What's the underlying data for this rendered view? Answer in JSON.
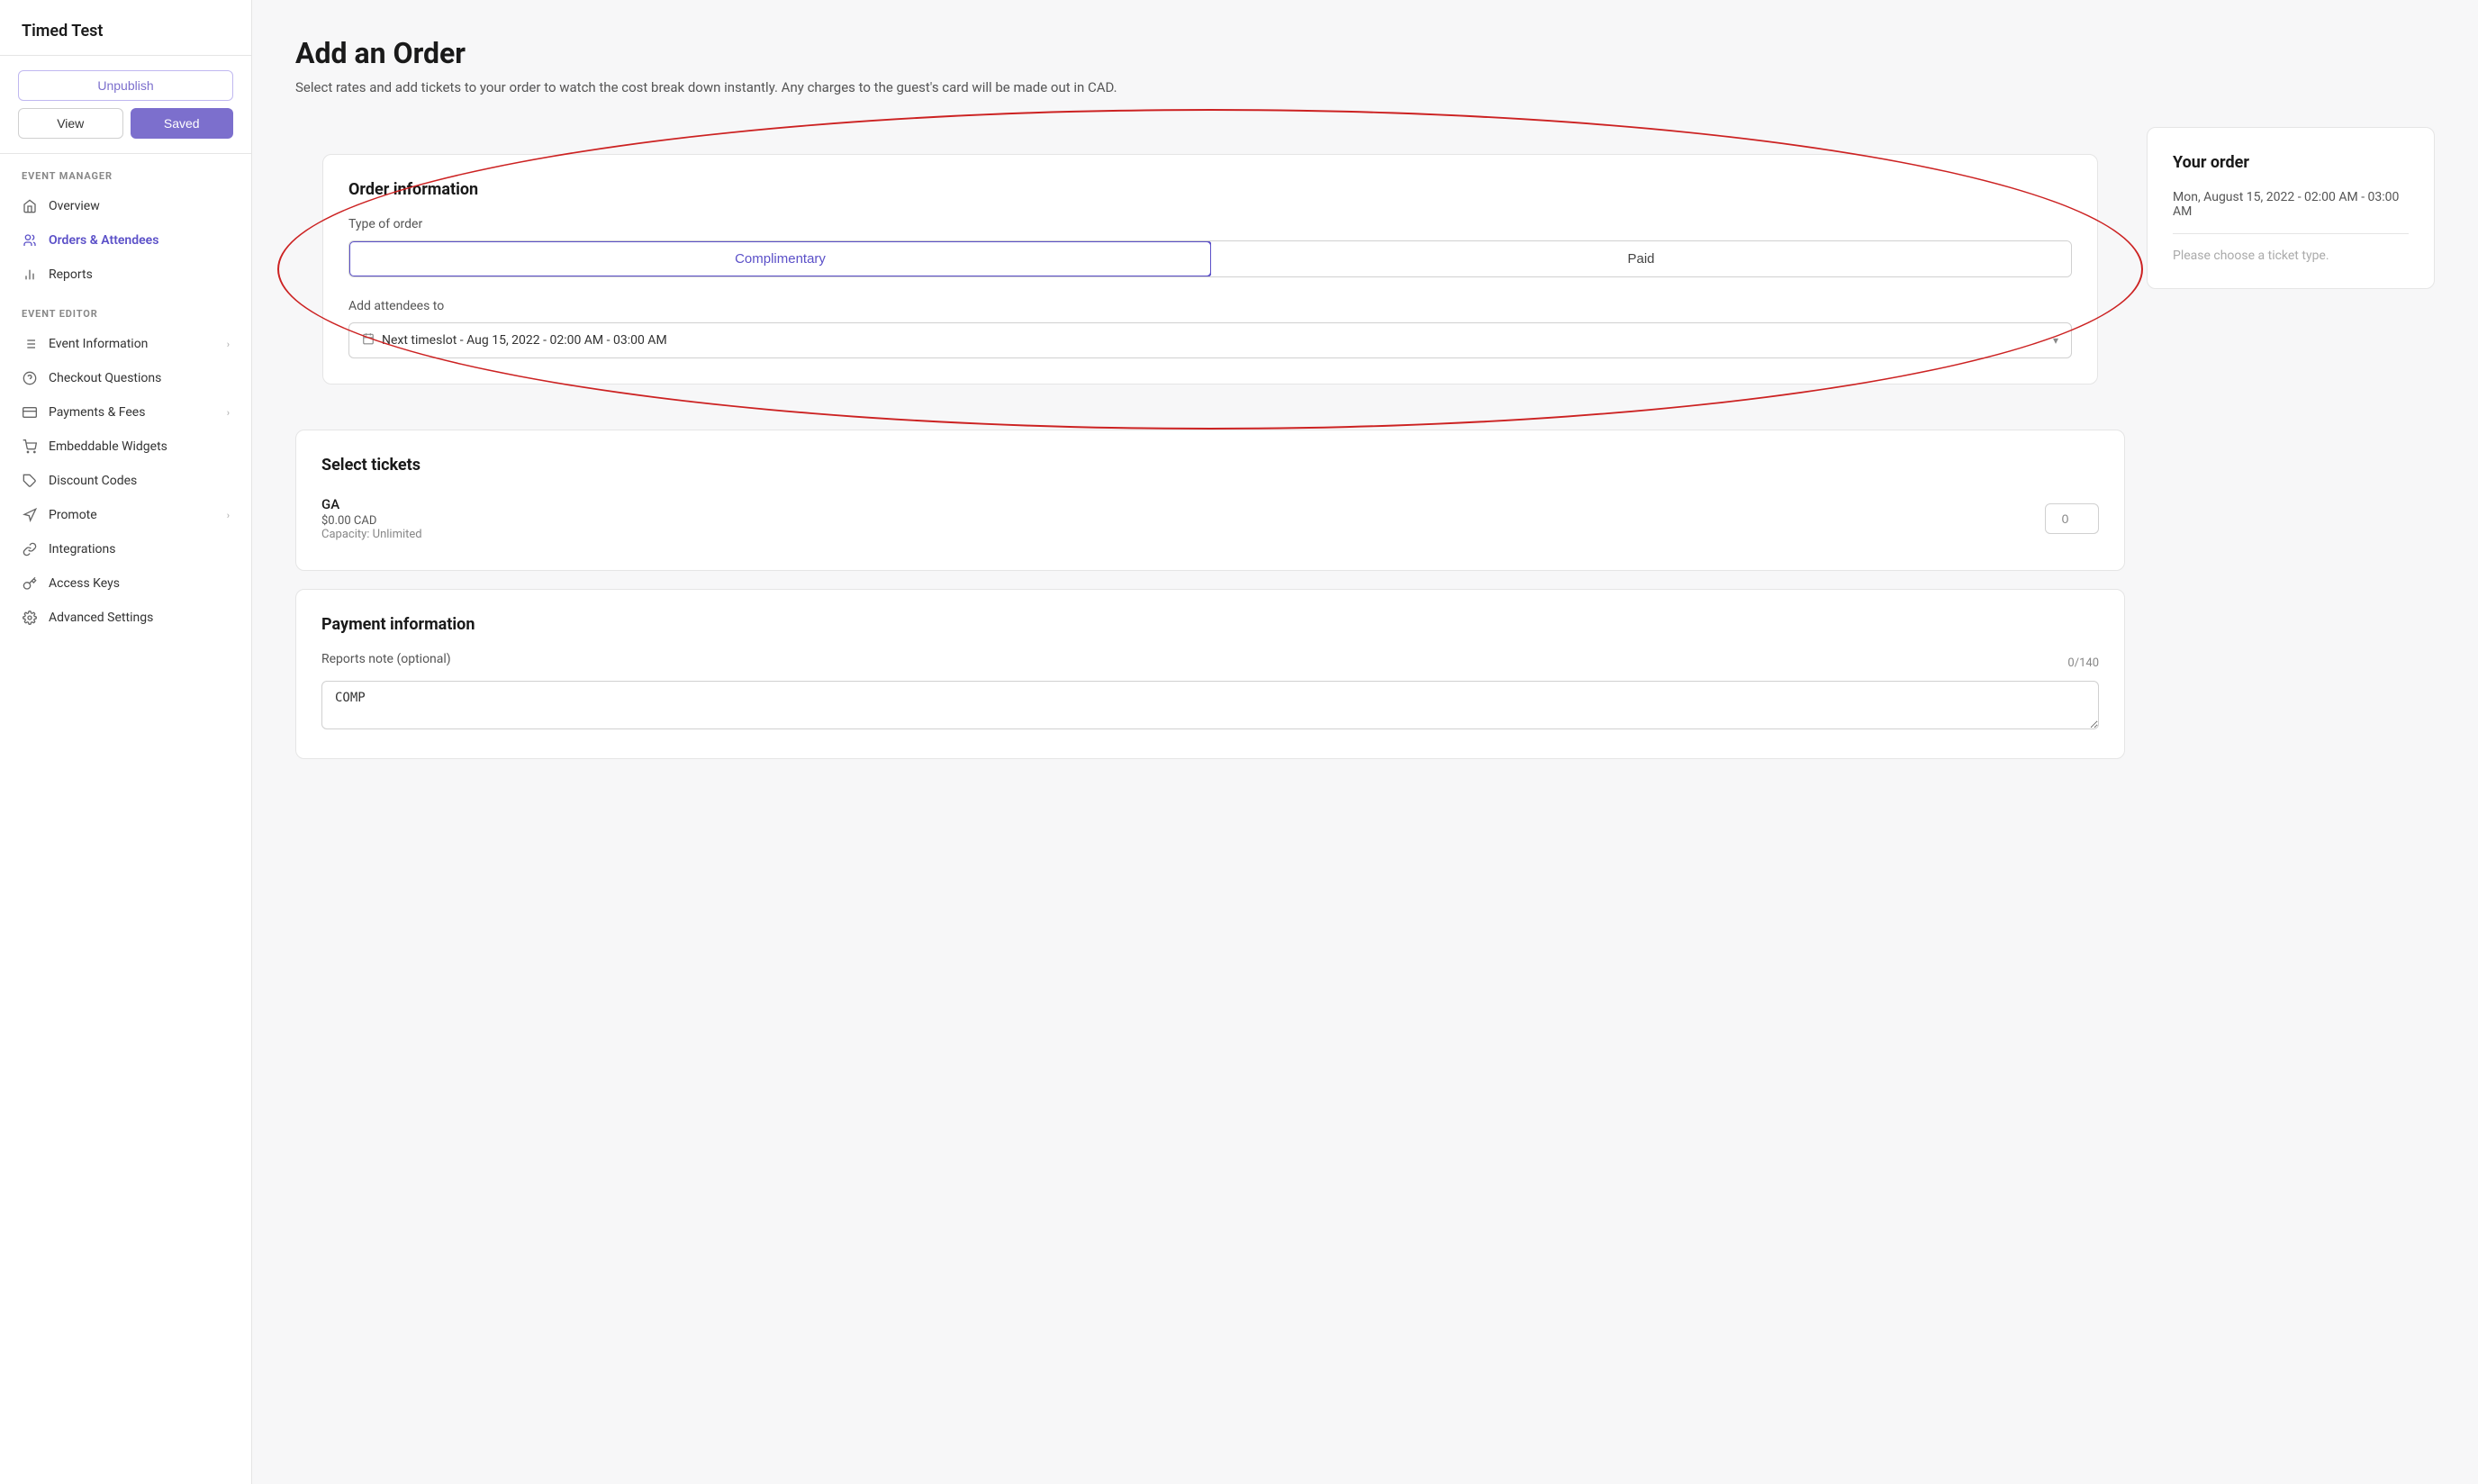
{
  "sidebar": {
    "title": "Timed Test",
    "buttons": {
      "unpublish": "Unpublish",
      "view": "View",
      "saved": "Saved"
    },
    "event_manager_label": "EVENT MANAGER",
    "event_manager_items": [
      {
        "id": "overview",
        "label": "Overview",
        "icon": "home"
      },
      {
        "id": "orders-attendees",
        "label": "Orders & Attendees",
        "icon": "people",
        "active": true
      },
      {
        "id": "reports",
        "label": "Reports",
        "icon": "bar-chart"
      }
    ],
    "event_editor_label": "EVENT EDITOR",
    "event_editor_items": [
      {
        "id": "event-information",
        "label": "Event Information",
        "icon": "list",
        "has_chevron": true
      },
      {
        "id": "checkout-questions",
        "label": "Checkout Questions",
        "icon": "circle-question"
      },
      {
        "id": "payments-fees",
        "label": "Payments & Fees",
        "icon": "credit-card",
        "has_chevron": true
      },
      {
        "id": "embeddable-widgets",
        "label": "Embeddable Widgets",
        "icon": "shopping-cart"
      },
      {
        "id": "discount-codes",
        "label": "Discount Codes",
        "icon": "tag"
      },
      {
        "id": "promote",
        "label": "Promote",
        "icon": "megaphone",
        "has_chevron": true
      },
      {
        "id": "integrations",
        "label": "Integrations",
        "icon": "link"
      },
      {
        "id": "access-keys",
        "label": "Access Keys",
        "icon": "key"
      },
      {
        "id": "advanced-settings",
        "label": "Advanced Settings",
        "icon": "gear"
      }
    ]
  },
  "main": {
    "page_title": "Add an Order",
    "page_subtitle": "Select rates and add tickets to your order to watch the cost break down instantly. Any charges to the guest's card will be made out in CAD.",
    "order_information": {
      "section_title": "Order information",
      "type_of_order_label": "Type of order",
      "type_buttons": [
        {
          "id": "complimentary",
          "label": "Complimentary",
          "active": true
        },
        {
          "id": "paid",
          "label": "Paid",
          "active": false
        }
      ],
      "add_attendees_label": "Add attendees to",
      "timeslot_value": "Next timeslot - Aug 15, 2022 - 02:00 AM - 03:00 AM"
    },
    "select_tickets": {
      "section_title": "Select tickets",
      "tickets": [
        {
          "name": "GA",
          "price": "$0.00 CAD",
          "capacity": "Capacity: Unlimited",
          "quantity": "0"
        }
      ]
    },
    "payment_information": {
      "section_title": "Payment information",
      "reports_note_label": "Reports note (optional)",
      "char_count": "0/140",
      "reports_note_value": "COMP"
    },
    "your_order": {
      "section_title": "Your order",
      "date_line": "Mon, August 15, 2022 - 02:00 AM - 03:00 AM",
      "placeholder": "Please choose a ticket type."
    }
  }
}
